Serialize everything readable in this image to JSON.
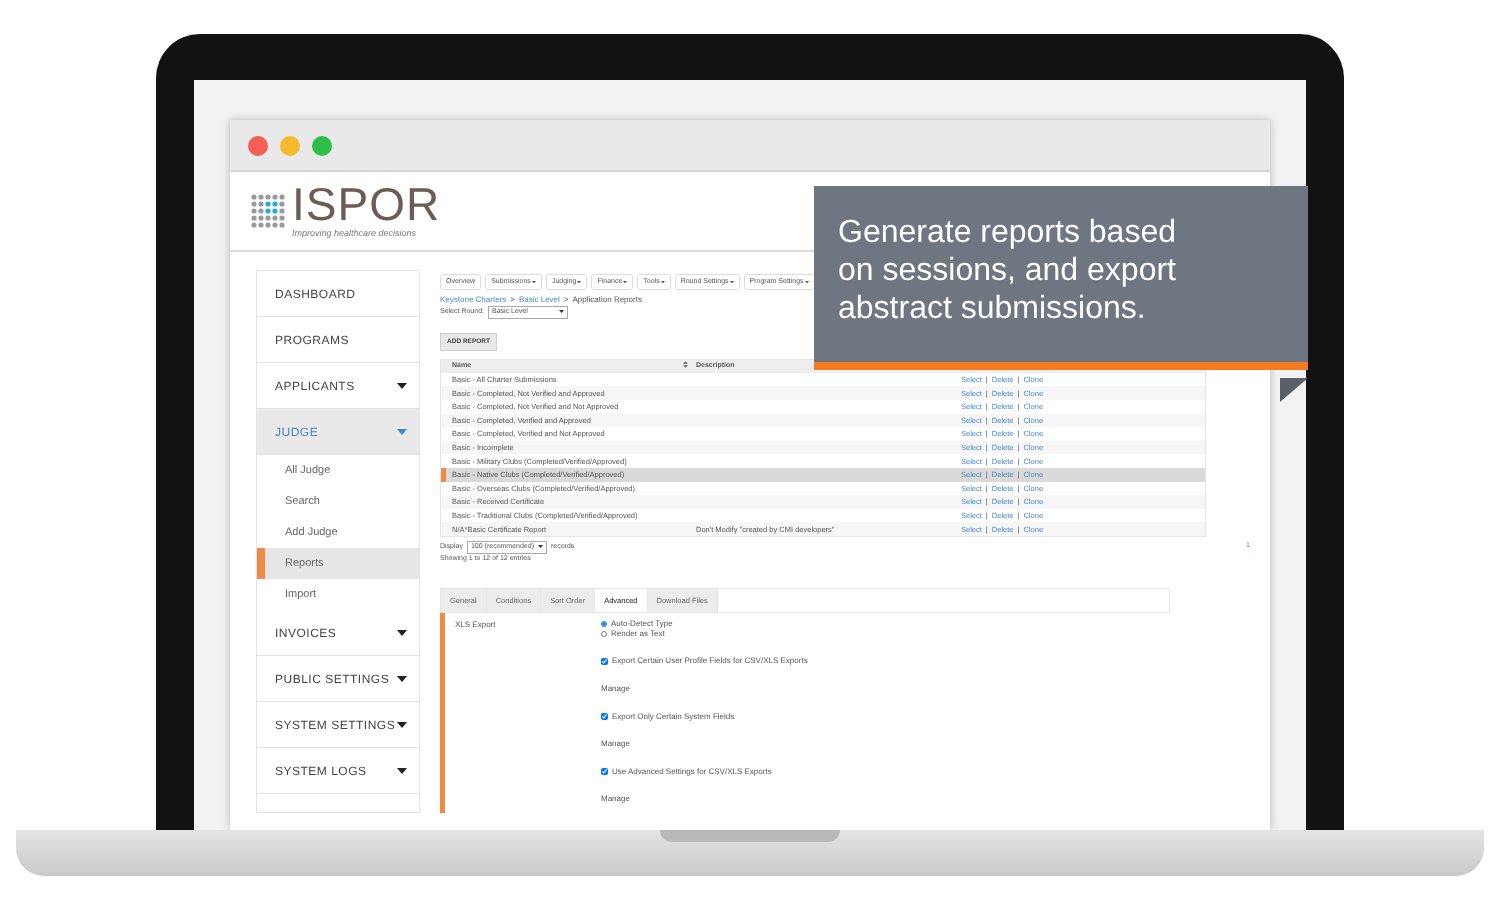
{
  "callout": {
    "text": "Generate reports based on sessions, and export abstract submissions."
  },
  "header": {
    "logo": "ISPOR",
    "tagline": "Improving healthcare decisions"
  },
  "sidebar": {
    "items": [
      {
        "label": "DASHBOARD",
        "caret": false,
        "expanded": false
      },
      {
        "label": "PROGRAMS",
        "caret": false,
        "expanded": false
      },
      {
        "label": "APPLICANTS",
        "caret": true,
        "expanded": false
      },
      {
        "label": "JUDGE",
        "caret": true,
        "expanded": true,
        "children": [
          {
            "label": "All Judge",
            "selected": false
          },
          {
            "label": "Search",
            "selected": false
          },
          {
            "label": "Add Judge",
            "selected": false
          },
          {
            "label": "Reports",
            "selected": true
          },
          {
            "label": "Import",
            "selected": false
          }
        ]
      },
      {
        "label": "INVOICES",
        "caret": true,
        "expanded": false
      },
      {
        "label": "PUBLIC SETTINGS",
        "caret": true,
        "expanded": false
      },
      {
        "label": "SYSTEM SETTINGS",
        "caret": true,
        "expanded": false
      },
      {
        "label": "SYSTEM LOGS",
        "caret": true,
        "expanded": false
      }
    ]
  },
  "nav_buttons": [
    {
      "label": "Overview",
      "dropdown": false
    },
    {
      "label": "Submissions",
      "dropdown": true
    },
    {
      "label": "Judging",
      "dropdown": true
    },
    {
      "label": "Finance",
      "dropdown": true
    },
    {
      "label": "Tools",
      "dropdown": true
    },
    {
      "label": "Round Settings",
      "dropdown": true
    },
    {
      "label": "Program Settings",
      "dropdown": true
    }
  ],
  "breadcrumb": {
    "items": [
      {
        "label": "Keystone Charters",
        "link": true
      },
      {
        "label": ">",
        "link": false
      },
      {
        "label": "Basic Level",
        "link": true
      },
      {
        "label": ">",
        "link": false
      },
      {
        "label": "Application Reports",
        "link": false
      }
    ]
  },
  "select_round": {
    "label": "Select Round:",
    "value": "Basic Level"
  },
  "add_report_button": "ADD REPORT",
  "table": {
    "columns": [
      "Name",
      "Description"
    ],
    "action_separator": "|",
    "rows": [
      {
        "name": "Basic - All Charter Submissions",
        "actions": [
          "Select",
          "Delete",
          "Clone"
        ],
        "selected": false
      },
      {
        "name": "Basic - Completed, Not Verified and Approved",
        "actions": [
          "Select",
          "Delete",
          "Clone"
        ],
        "selected": false
      },
      {
        "name": "Basic - Completed, Not Verified and Not Approved",
        "actions": [
          "Select",
          "Delete",
          "Clone"
        ],
        "selected": false
      },
      {
        "name": "Basic - Completed, Verified and Approved",
        "actions": [
          "Select",
          "Delete",
          "Clone"
        ],
        "selected": false
      },
      {
        "name": "Basic - Completed, Verified and Not Approved",
        "actions": [
          "Select",
          "Delete",
          "Clone"
        ],
        "selected": false
      },
      {
        "name": "Basic - Incomplete",
        "actions": [
          "Select",
          "Delete",
          "Clone"
        ],
        "selected": false
      },
      {
        "name": "Basic - Military Clubs (Completed/Verified/Approved)",
        "actions": [
          "Select",
          "Delete",
          "Clone"
        ],
        "selected": false
      },
      {
        "name": "Basic - Native Clubs (Completed/Verified/Approved)",
        "actions": [
          "Select",
          "Delete",
          "Clone"
        ],
        "selected": true
      },
      {
        "name": "Basic - Overseas Clubs (Completed/Verified/Approved)",
        "actions": [
          "Select",
          "Delete",
          "Clone"
        ],
        "selected": false
      },
      {
        "name": "Basic - Received Certificate",
        "actions": [
          "Select",
          "Delete",
          "Clone"
        ],
        "selected": false
      },
      {
        "name": "Basic - Traditional Clubs (Completed/Verified/Approved)",
        "actions": [
          "Select",
          "Delete",
          "Clone"
        ],
        "selected": false
      },
      {
        "name": "N/A*Basic Certificate Report",
        "description": "Don't Modify \"created by CMI developers\"",
        "actions": [
          "Select",
          "Delete",
          "Clone"
        ],
        "selected": false
      }
    ]
  },
  "display": {
    "label": "Display",
    "value": "100 (recommended)",
    "suffix": "records",
    "showing": "Showing 1 to 12 of 12 entries",
    "page": "1"
  },
  "tabs": [
    {
      "label": "General",
      "selected": false
    },
    {
      "label": "Conditions",
      "selected": false
    },
    {
      "label": "Sort Order",
      "selected": false
    },
    {
      "label": "Advanced",
      "selected": true
    },
    {
      "label": "Download Files",
      "selected": false
    }
  ],
  "settings": {
    "section": "XLS Export",
    "options": [
      {
        "kind": "radio",
        "label": "Auto-Detect Type",
        "checked": true
      },
      {
        "kind": "radio",
        "label": "Render as Text",
        "checked": false
      },
      {
        "kind": "checkbox",
        "label": "Export Certain User Profile Fields for CSV/XLS Exports",
        "checked": true
      },
      {
        "kind": "link",
        "label": "Manage"
      },
      {
        "kind": "checkbox",
        "label": "Export Only Certain System Fields",
        "checked": true
      },
      {
        "kind": "link",
        "label": "Manage"
      },
      {
        "kind": "checkbox",
        "label": "Use Advanced Settings for CSV/XLS Exports",
        "checked": true
      },
      {
        "kind": "link",
        "label": "Manage"
      }
    ]
  }
}
